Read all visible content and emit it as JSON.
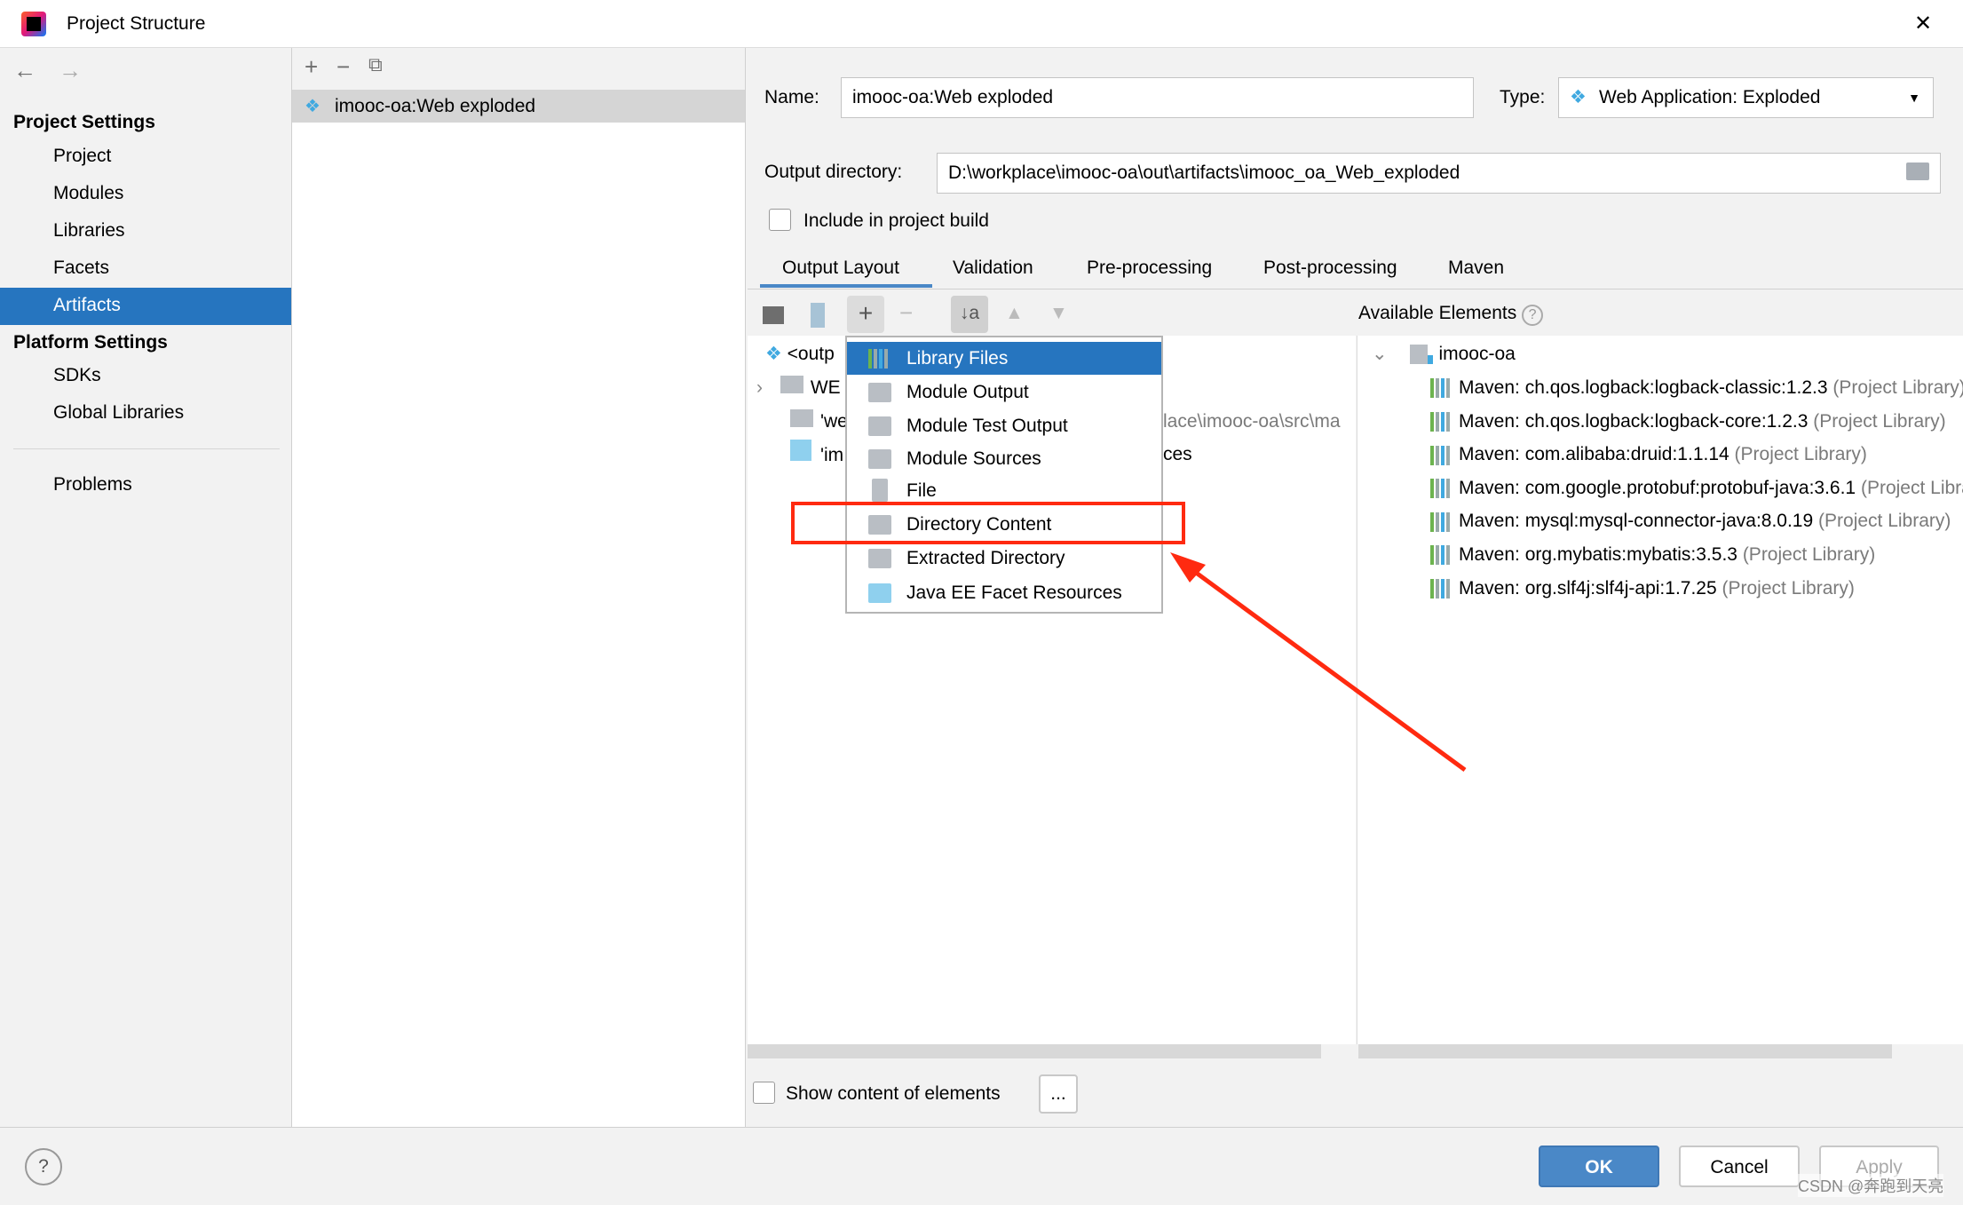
{
  "window": {
    "title": "Project Structure",
    "close": "✕"
  },
  "nav": {
    "back": "←",
    "forward": "→"
  },
  "sidebar": {
    "project_settings": "Project Settings",
    "items": [
      "Project",
      "Modules",
      "Libraries",
      "Facets",
      "Artifacts"
    ],
    "selected": "Artifacts",
    "platform_settings": "Platform Settings",
    "platform_items": [
      "SDKs",
      "Global Libraries"
    ],
    "problems": "Problems"
  },
  "artifacts": {
    "toolbar": {
      "add": "+",
      "remove": "−",
      "copy": "⧉"
    },
    "items": [
      "imooc-oa:Web exploded"
    ]
  },
  "form": {
    "name_label": "Name:",
    "name_value": "imooc-oa:Web exploded",
    "type_label": "Type:",
    "type_value": "Web Application: Exploded",
    "output_label": "Output directory:",
    "output_value": "D:\\workplace\\imooc-oa\\out\\artifacts\\imooc_oa_Web_exploded",
    "include_label": "Include in project build",
    "include_checked": false
  },
  "tabs": [
    "Output Layout",
    "Validation",
    "Pre-processing",
    "Post-processing",
    "Maven"
  ],
  "active_tab": "Output Layout",
  "layout_tree": [
    {
      "label": "<outp"
    },
    {
      "label": "WE"
    },
    {
      "label": "'we",
      "suffix": "lace\\imooc-oa\\src\\ma"
    },
    {
      "label": "'im",
      "suffix": "ces"
    }
  ],
  "popup": {
    "items": [
      "Library Files",
      "Module Output",
      "Module Test Output",
      "Module Sources",
      "File",
      "Directory Content",
      "Extracted Directory",
      "Java EE Facet Resources"
    ],
    "selected": "Library Files",
    "highlighted": "Directory Content"
  },
  "available": {
    "title": "Available Elements",
    "help": "?",
    "root": "imooc-oa",
    "items": [
      {
        "name": "Maven: ch.qos.logback:logback-classic:1.2.3",
        "note": "(Project Library)"
      },
      {
        "name": "Maven: ch.qos.logback:logback-core:1.2.3",
        "note": "(Project Library)"
      },
      {
        "name": "Maven: com.alibaba:druid:1.1.14",
        "note": "(Project Library)"
      },
      {
        "name": "Maven: com.google.protobuf:protobuf-java:3.6.1",
        "note": "(Project Library)"
      },
      {
        "name": "Maven: mysql:mysql-connector-java:8.0.19",
        "note": "(Project Library)"
      },
      {
        "name": "Maven: org.mybatis:mybatis:3.5.3",
        "note": "(Project Library)"
      },
      {
        "name": "Maven: org.slf4j:slf4j-api:1.7.25",
        "note": "(Project Library)"
      }
    ]
  },
  "bottom": {
    "show_content": "Show content of elements",
    "ellipsis": "...",
    "help": "?",
    "ok": "OK",
    "cancel": "Cancel",
    "apply": "Apply"
  },
  "watermark": "CSDN @奔跑到天亮",
  "colors": {
    "accent": "#2675bf",
    "annotation": "#ff2a10",
    "ok_button": "#4a88c7"
  }
}
